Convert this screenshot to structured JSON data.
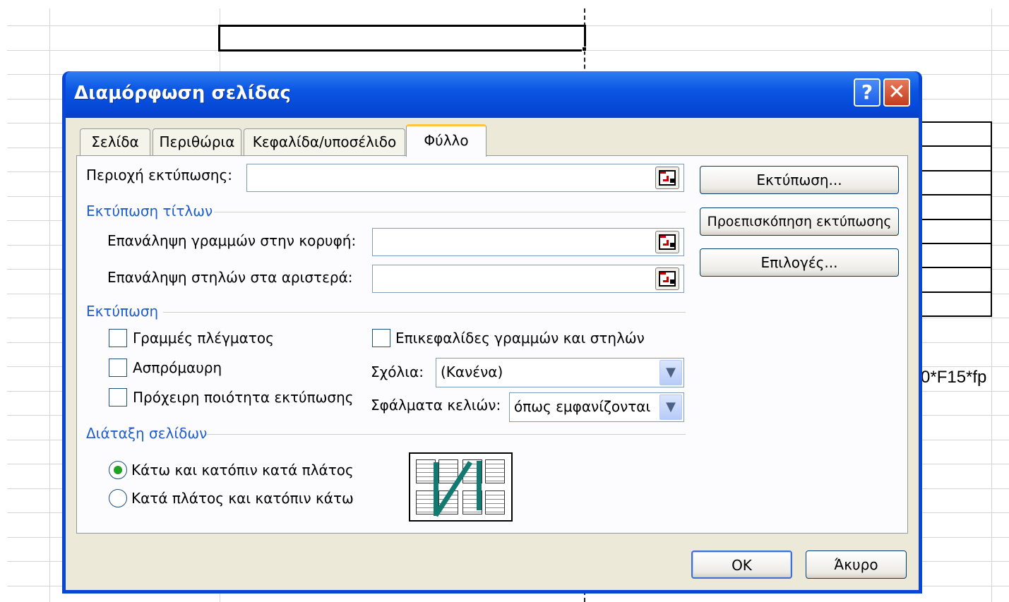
{
  "sheet": {
    "cell_text": "0*F15*fp"
  },
  "dialog": {
    "title": "Διαμόρφωση σελίδας",
    "help_glyph": "?",
    "close_glyph": "✕",
    "tabs": [
      {
        "label": "Σελίδα"
      },
      {
        "label": "Περιθώρια"
      },
      {
        "label": "Κεφαλίδα/υποσέλιδο"
      },
      {
        "label": "Φύλλο",
        "active": true
      }
    ],
    "print_area": {
      "label": "Περιοχή εκτύπωσης:",
      "value": ""
    },
    "print_titles": {
      "heading": "Εκτύπωση τίτλων",
      "rows_label": "Επανάληψη γραμμών στην κορυφή:",
      "rows_value": "",
      "cols_label": "Επανάληψη στηλών στα αριστερά:",
      "cols_value": ""
    },
    "print": {
      "heading": "Εκτύπωση",
      "gridlines": {
        "label": "Γραμμές πλέγματος",
        "checked": false
      },
      "black_white": {
        "label": "Ασπρόμαυρη",
        "checked": false
      },
      "draft": {
        "label": "Πρόχειρη ποιότητα εκτύπωσης",
        "checked": false
      },
      "headings": {
        "label": "Επικεφαλίδες γραμμών και στηλών",
        "checked": false
      },
      "comments_label": "Σχόλια:",
      "comments_value": "(Κανένα)",
      "errors_label": "Σφάλματα κελιών:",
      "errors_value": "όπως εμφανίζονται"
    },
    "page_order": {
      "heading": "Διάταξη σελίδων",
      "down_then_over": {
        "label": "Κάτω και κατόπιν κατά πλάτος",
        "selected": true
      },
      "over_then_down": {
        "label": "Κατά πλάτος και κατόπιν κάτω",
        "selected": false
      }
    },
    "side_buttons": {
      "print": "Εκτύπωση...",
      "preview": "Προεπισκόπηση εκτύπωσης",
      "options": "Επιλογές..."
    },
    "ok_label": "OK",
    "cancel_label": "Άκυρο",
    "icons": {
      "ref": "collapse-dialog-icon",
      "dropdown": "chevron-down-icon"
    },
    "colors": {
      "title_blue": "#0a46d6",
      "group_blue": "#1f5ecc",
      "tab_highlight": "#ffc83c"
    }
  }
}
